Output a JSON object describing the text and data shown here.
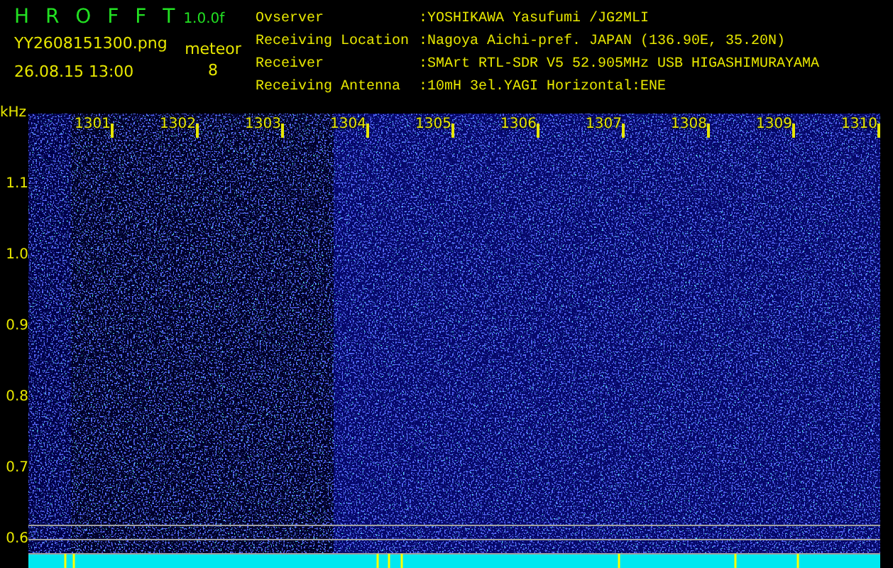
{
  "header": {
    "title": "H R O F F T",
    "version": "1.0.0f",
    "filename": "YY2608151300.png",
    "timestamp": "26.08.15 13:00",
    "meteor_label": "meteor",
    "meteor_count": "8"
  },
  "info": [
    {
      "label": "Ovserver",
      "value": ":YOSHIKAWA Yasufumi /JG2MLI"
    },
    {
      "label": "Receiving Location",
      "value": ":Nagoya Aichi-pref. JAPAN (136.90E, 35.20N)"
    },
    {
      "label": "Receiver",
      "value": ":SMArt RTL-SDR V5 52.905MHz USB HIGASHIMURAYAMA"
    },
    {
      "label": "Receiving Antenna",
      "value": ":10mH 3el.YAGI Horizontal:ENE"
    }
  ],
  "plot": {
    "y_unit": "kHz",
    "y_labels": [
      "1.1",
      "1.0",
      "0.9",
      "0.8",
      "0.7",
      "0.6"
    ],
    "x_labels": [
      "1301",
      "1302",
      "1303",
      "1304",
      "1305",
      "1306",
      "1307",
      "1308",
      "1309",
      "1310"
    ]
  }
}
